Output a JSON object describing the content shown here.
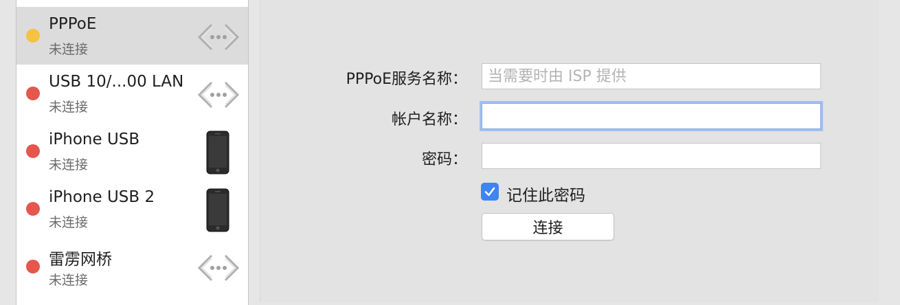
{
  "sidebar": {
    "items": [
      {
        "name": "PPPoE",
        "status": "未连接",
        "status_color": "#f5c244",
        "icon": "network-arrows-icon",
        "selected": true
      },
      {
        "name": "USB 10/...00 LAN",
        "status": "未连接",
        "status_color": "#e5564d",
        "icon": "network-arrows-icon",
        "selected": false
      },
      {
        "name": "iPhone USB",
        "status": "未连接",
        "status_color": "#e5564d",
        "icon": "iphone-icon",
        "selected": false
      },
      {
        "name": "iPhone USB 2",
        "status": "未连接",
        "status_color": "#e5564d",
        "icon": "iphone-icon",
        "selected": false
      },
      {
        "name": "雷雳网桥",
        "status": "未连接",
        "status_color": "#e5564d",
        "icon": "network-arrows-icon",
        "selected": false
      }
    ]
  },
  "form": {
    "service_name_label": "PPPoE服务名称：",
    "service_name_placeholder": "当需要时由 ISP 提供",
    "service_name_value": "",
    "account_label": "帐户名称：",
    "account_value": "",
    "password_label": "密码：",
    "password_value": "",
    "remember_label": "记住此密码",
    "remember_checked": true,
    "connect_label": "连接"
  },
  "colors": {
    "accent": "#3d85f0",
    "status_yellow": "#f5c244",
    "status_red": "#e5564d"
  }
}
